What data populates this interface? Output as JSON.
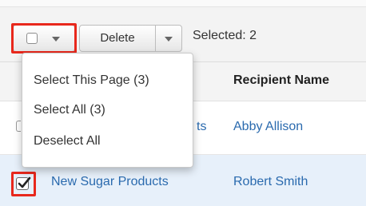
{
  "toolbar": {
    "delete_label": "Delete",
    "selected_text": "Selected: 2"
  },
  "table": {
    "columns": [
      "Recipient Name"
    ],
    "rows": [
      {
        "subject_truncated": "ts",
        "recipient": "Abby Allison",
        "checked": false
      },
      {
        "subject": "New Sugar Products",
        "recipient": "Robert Smith",
        "checked": true
      }
    ]
  },
  "dropdown": {
    "items": [
      "Select This Page (3)",
      "Select All (3)",
      "Deselect All"
    ]
  },
  "icons": {
    "select_checkbox": "checkbox-empty-icon",
    "select_caret": "chevron-down-icon",
    "delete_caret": "chevron-down-icon",
    "row_checkbox_checked": "checkbox-checked-icon"
  },
  "colors": {
    "highlight": "#e8281c",
    "link": "#2a6aae",
    "selected_row": "#e7f0fa"
  }
}
